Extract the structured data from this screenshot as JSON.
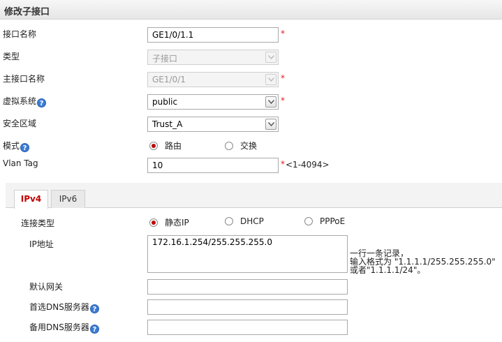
{
  "header": {
    "title": "修改子接口"
  },
  "form": {
    "interface_name": {
      "label": "接口名称",
      "value": "GE1/0/1.1",
      "required": "*"
    },
    "type": {
      "label": "类型",
      "value": "子接口"
    },
    "main_interface": {
      "label": "主接口名称",
      "value": "GE1/0/1",
      "required": "*"
    },
    "vsys": {
      "label": "虚拟系统",
      "value": "public",
      "required": "*"
    },
    "zone": {
      "label": "安全区域",
      "value": "Trust_A"
    },
    "mode": {
      "label": "模式",
      "options": [
        "路由",
        "交换"
      ],
      "selected": "路由"
    },
    "vlan_tag": {
      "label": "Vlan Tag",
      "value": "10",
      "required": "*",
      "range": "<1-4094>"
    }
  },
  "tabs": [
    {
      "label": "IPv4",
      "active": true
    },
    {
      "label": "IPv6",
      "active": false
    }
  ],
  "ipv4": {
    "conn_type": {
      "label": "连接类型",
      "options": [
        "静态IP",
        "DHCP",
        "PPPoE"
      ],
      "selected": "静态IP"
    },
    "ip_address": {
      "label": "IP地址",
      "value": "172.16.1.254/255.255.255.0",
      "hint_lines": [
        "一行一条记录，",
        "输入格式为 \"1.1.1.1/255.255.255.0\"",
        "或者\"1.1.1.1/24\"。"
      ]
    },
    "gateway": {
      "label": "默认网关",
      "value": ""
    },
    "dns_primary": {
      "label": "首选DNS服务器",
      "value": ""
    },
    "dns_secondary": {
      "label": "备用DNS服务器",
      "value": ""
    }
  },
  "icons": {
    "help": "?"
  },
  "colors": {
    "accent": "#c00000",
    "required": "#e02020",
    "help": "#3a7bd5"
  }
}
